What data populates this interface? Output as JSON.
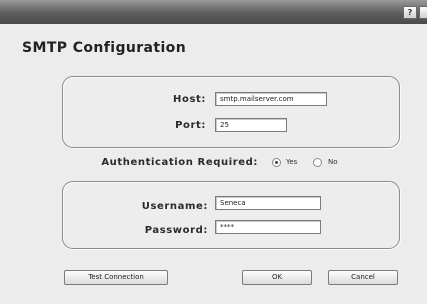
{
  "window": {
    "help_button": "?"
  },
  "dialog": {
    "title": "SMTP Configuration"
  },
  "server": {
    "host_label": "Host:",
    "host_value": "smtp.mailserver.com",
    "port_label": "Port:",
    "port_value": "25"
  },
  "auth": {
    "label": "Authentication Required:",
    "options": [
      {
        "label": "Yes",
        "selected": true
      },
      {
        "label": "No",
        "selected": false
      }
    ]
  },
  "credentials": {
    "username_label": "Username:",
    "username_value": "Seneca",
    "password_label": "Password:",
    "password_value": "****"
  },
  "buttons": {
    "test_connection": "Test Connection",
    "ok": "OK",
    "cancel": "Cancel"
  }
}
